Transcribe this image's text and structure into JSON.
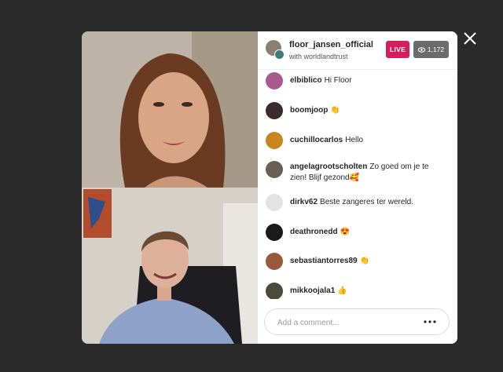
{
  "stream": {
    "host_username": "floor_jansen_official",
    "with_text": "with worldlandtrust",
    "live_label": "LIVE",
    "viewer_count": "1,172"
  },
  "comments": [
    {
      "username": "elbiblico",
      "text": "Hi Floor",
      "avatar_color": "#a85a8c"
    },
    {
      "username": "boomjoop",
      "text": "👏",
      "avatar_color": "#3b2b2b"
    },
    {
      "username": "cuchillocarlos",
      "text": "Hello",
      "avatar_color": "#c8861f"
    },
    {
      "username": "angelagrootscholten",
      "text": "Zo goed om je te zien! Blijf gezond🥰",
      "avatar_color": "#6a5f55"
    },
    {
      "username": "dirkv62",
      "text": "Beste zangeres ter wereld.",
      "avatar_color": "#e3e3e3"
    },
    {
      "username": "deathronedd",
      "text": "😍",
      "avatar_color": "#1b1b1b"
    },
    {
      "username": "sebastiantorres89",
      "text": "👏",
      "avatar_color": "#9a5a3a"
    },
    {
      "username": "mikkoojala1",
      "text": "👍",
      "avatar_color": "#4b4b3b"
    }
  ],
  "composer": {
    "placeholder": "Add a comment...",
    "more_label": "•••"
  },
  "colors": {
    "backdrop": "#2b2b2b",
    "live_badge": "#d81d5c",
    "viewer_badge": "#6b6b6b"
  },
  "icons": [
    "close-icon",
    "eye-icon",
    "more-options-icon"
  ]
}
